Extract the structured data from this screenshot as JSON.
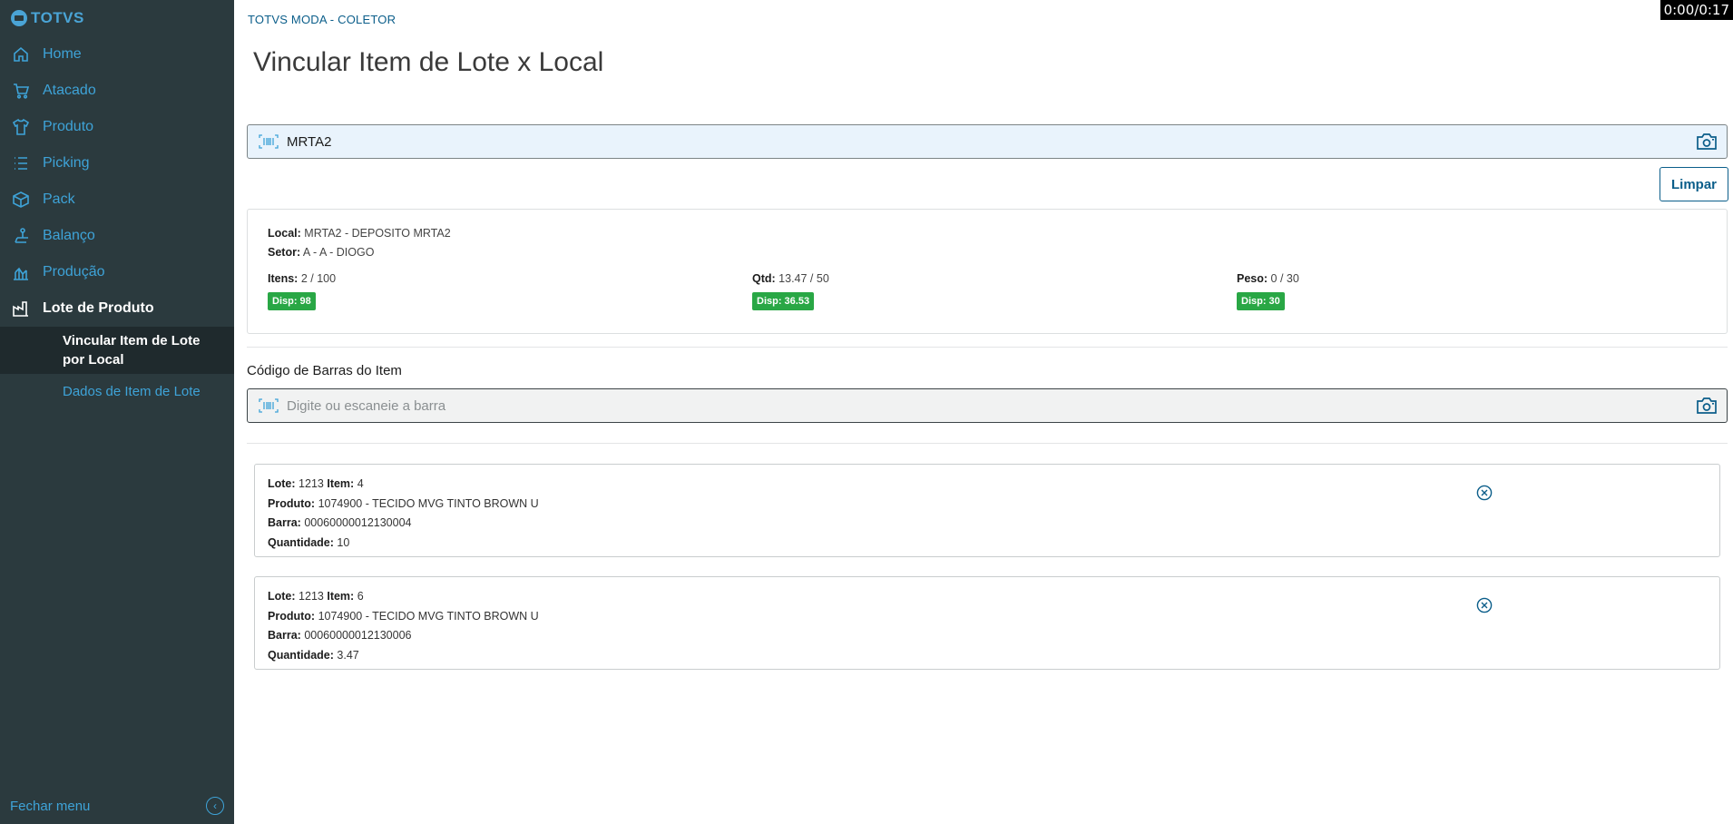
{
  "sidebar": {
    "brand": "TOTVS",
    "items": [
      {
        "label": "Home",
        "icon": "home-icon"
      },
      {
        "label": "Atacado",
        "icon": "cart-icon"
      },
      {
        "label": "Produto",
        "icon": "shirt-icon"
      },
      {
        "label": "Picking",
        "icon": "list-icon"
      },
      {
        "label": "Pack",
        "icon": "box-icon"
      },
      {
        "label": "Balanço",
        "icon": "scale-icon"
      },
      {
        "label": "Produção",
        "icon": "chart-icon"
      },
      {
        "label": "Lote de Produto",
        "icon": "factory-icon"
      }
    ],
    "subitems": [
      {
        "label": "Vincular Item de Lote por Local"
      },
      {
        "label": "Dados de Item de Lote"
      }
    ],
    "close_label": "Fechar menu"
  },
  "header": {
    "breadcrumb": "TOTVS MODA - COLETOR",
    "title": "Vincular Item de Lote x Local",
    "timer": "0:00/0:17"
  },
  "local_input": {
    "value": "MRTA2"
  },
  "clear_label": "Limpar",
  "local_card": {
    "local_label": "Local:",
    "local_value": "MRTA2 - DEPOSITO MRTA2",
    "setor_label": "Setor:",
    "setor_value": "A - A - DIOGO",
    "stats": [
      {
        "label": "Itens:",
        "value": "2 / 100",
        "badge": "Disp: 98"
      },
      {
        "label": "Qtd:",
        "value": "13.47 / 50",
        "badge": "Disp: 36.53"
      },
      {
        "label": "Peso:",
        "value": "0 / 30",
        "badge": "Disp: 30"
      }
    ]
  },
  "item_barcode": {
    "label": "Código de Barras do Item",
    "placeholder": "Digite ou escaneie a barra"
  },
  "field_labels": {
    "lote": "Lote:",
    "item": "Item:",
    "produto": "Produto:",
    "barra": "Barra:",
    "quantidade": "Quantidade:"
  },
  "items": [
    {
      "lote": "1213",
      "item": "4",
      "produto": "1074900 - TECIDO MVG TINTO BROWN U",
      "barra": "00060000012130004",
      "quantidade": "10"
    },
    {
      "lote": "1213",
      "item": "6",
      "produto": "1074900 - TECIDO MVG TINTO BROWN U",
      "barra": "00060000012130006",
      "quantidade": "3.47"
    }
  ],
  "colors": {
    "sidebar_bg": "#2b3a3e",
    "accent": "#3ea3d8",
    "primary": "#0b5e8a",
    "badge_green": "#29a745"
  }
}
